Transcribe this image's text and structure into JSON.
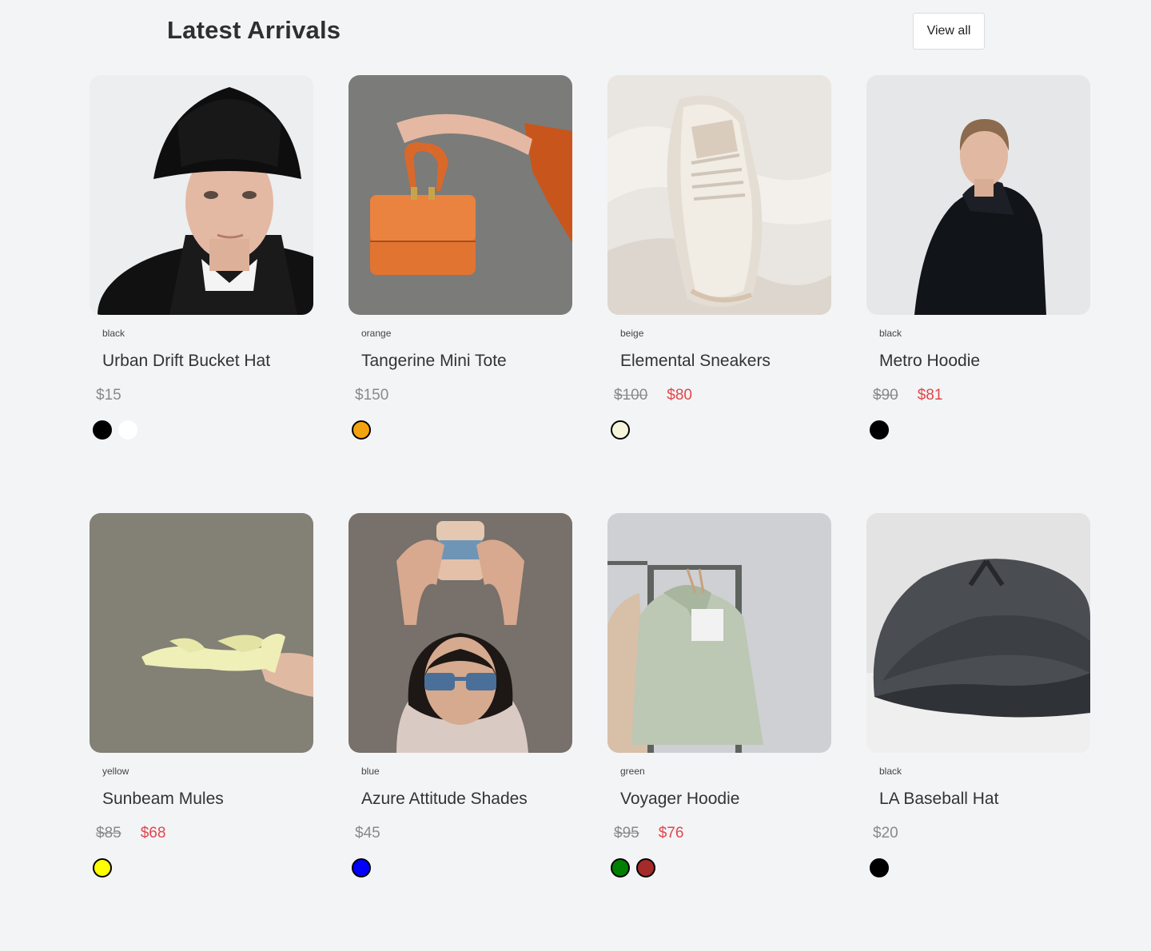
{
  "header": {
    "title": "Latest Arrivals",
    "view_all_label": "View all"
  },
  "products": [
    {
      "color_name": "black",
      "name": "Urban Drift Bucket Hat",
      "price": "$15",
      "old_price": null,
      "sale_price": null,
      "swatches": [
        "#000000",
        "#ffffff"
      ]
    },
    {
      "color_name": "orange",
      "name": "Tangerine Mini Tote",
      "price": "$150",
      "old_price": null,
      "sale_price": null,
      "swatches": [
        "#f5a20f"
      ]
    },
    {
      "color_name": "beige",
      "name": "Elemental Sneakers",
      "price": null,
      "old_price": "$100",
      "sale_price": "$80",
      "swatches": [
        "#f5f5dc"
      ]
    },
    {
      "color_name": "black",
      "name": "Metro Hoodie",
      "price": null,
      "old_price": "$90",
      "sale_price": "$81",
      "swatches": [
        "#000000"
      ]
    },
    {
      "color_name": "yellow",
      "name": "Sunbeam Mules",
      "price": null,
      "old_price": "$85",
      "sale_price": "$68",
      "swatches": [
        "#ffff00"
      ]
    },
    {
      "color_name": "blue",
      "name": "Azure Attitude Shades",
      "price": "$45",
      "old_price": null,
      "sale_price": null,
      "swatches": [
        "#0000ff"
      ]
    },
    {
      "color_name": "green",
      "name": "Voyager Hoodie",
      "price": null,
      "old_price": "$95",
      "sale_price": "$76",
      "swatches": [
        "#008000",
        "#a52a2a"
      ]
    },
    {
      "color_name": "black",
      "name": "LA Baseball Hat",
      "price": "$20",
      "old_price": null,
      "sale_price": null,
      "swatches": [
        "#000000"
      ]
    }
  ],
  "colors": {
    "background": "#f3f4f6",
    "sale_price": "#e0474c",
    "regular_price": "#8a8a8a"
  }
}
